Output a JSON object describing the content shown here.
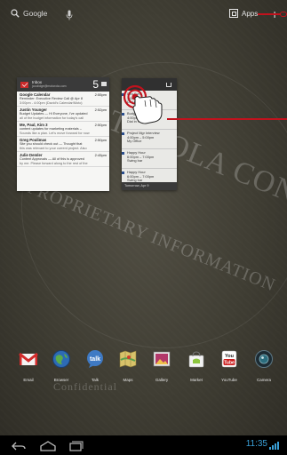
{
  "topbar": {
    "search_label": "Google",
    "apps_label": "Apps"
  },
  "watermark": {
    "line1": "MOTOROLA CONFIDENTIAL",
    "line2": "PROPRIETARY INFORMATION",
    "line3": "Confidential"
  },
  "email_widget": {
    "title": "Inbox",
    "account": "jcoolidge@motorola.com",
    "count": "5",
    "messages": [
      {
        "from": "Google Calendar",
        "time": "2:55pm",
        "subject": "Reminder: Executive Review Call @ Apr 8",
        "snippet": "3:00pm - 4:00pm (David's Calendar/Moto)"
      },
      {
        "from": "Justin Younger",
        "time": "2:52pm",
        "subject": "Budget Updates — Hi Everyone, I've updated",
        "snippet": "all of the budget information for today's call"
      },
      {
        "from": "Me, Paul, Kim 3",
        "time": "2:50pm",
        "subject": "content updates for marketing materials –",
        "snippet": "Sounds like a plan. Let's move forward for now"
      },
      {
        "from": "Greg Poulimas",
        "time": "2:50pm",
        "subject": "Site you should check out — Thought that",
        "snippet": "this was relevant to your current project. Also"
      },
      {
        "from": "Julie Demler",
        "time": "2:45pm",
        "subject": "Content Approvals — All of this is approved",
        "snippet": "by me. Please forward along to the rest of the"
      }
    ]
  },
  "calendar_widget": {
    "events": [
      {
        "lines": [
          "Dev Sync",
          "3:00 – 4:00pm",
          "Dial in number: 5"
        ]
      },
      {
        "lines": [
          "Budget Review",
          "4:00pm – 5:00pm",
          "Dial in number: 5"
        ]
      },
      {
        "lines": [
          "Project Mgr Interview",
          "4:00pm – 5:00pm",
          "My Office"
        ]
      },
      {
        "lines": [
          "Happy Hour",
          "6:00pm – 7:00pm",
          "Swing bar"
        ]
      },
      {
        "lines": [
          "Happy Hour",
          "6:00pm – 7:00pm",
          "Swing bar"
        ]
      }
    ],
    "footer": "Tomorrow, Apr 9"
  },
  "dock": {
    "apps": [
      {
        "label": "Email"
      },
      {
        "label": "Browser"
      },
      {
        "label": "Talk"
      },
      {
        "label": "Maps"
      },
      {
        "label": "Gallery"
      },
      {
        "label": "Market"
      },
      {
        "label": "YouTube"
      },
      {
        "label": "Camera"
      }
    ]
  },
  "statusbar": {
    "time": "11:35"
  },
  "colors": {
    "accent_red": "#c2121d",
    "clock_blue": "#3aa0d8",
    "calendar_bar": "#2a4f8f"
  }
}
